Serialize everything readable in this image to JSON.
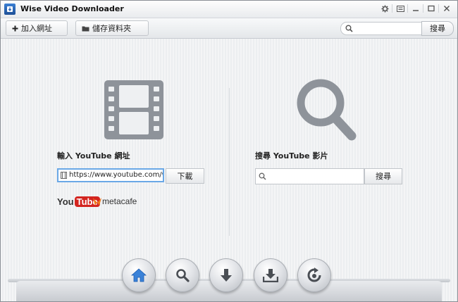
{
  "window": {
    "title": "Wise Video Downloader"
  },
  "toolbar": {
    "add_url_label": "加入網址",
    "save_folder_label": "儲存資料夾",
    "search_placeholder": "",
    "search_button_label": "搜尋"
  },
  "left_panel": {
    "heading": "輸入 YouTube 網址",
    "url_value": "https://www.youtube.com/watch?v=...",
    "download_button_label": "下載",
    "logos": {
      "youtube_you": "You",
      "youtube_tube": "Tube",
      "metacafe": "metacafe"
    }
  },
  "right_panel": {
    "heading": "搜尋 YouTube 影片",
    "search_value": "",
    "search_button_label": "搜尋"
  },
  "dock": {
    "items": [
      "home-icon",
      "search-icon",
      "download-icon",
      "save-download-icon",
      "convert-icon"
    ]
  },
  "colors": {
    "accent_blue": "#3a82d8",
    "input_focus": "#6aa8e6",
    "youtube_red": "#d3241f",
    "metacafe_orange": "#f07a1a"
  }
}
